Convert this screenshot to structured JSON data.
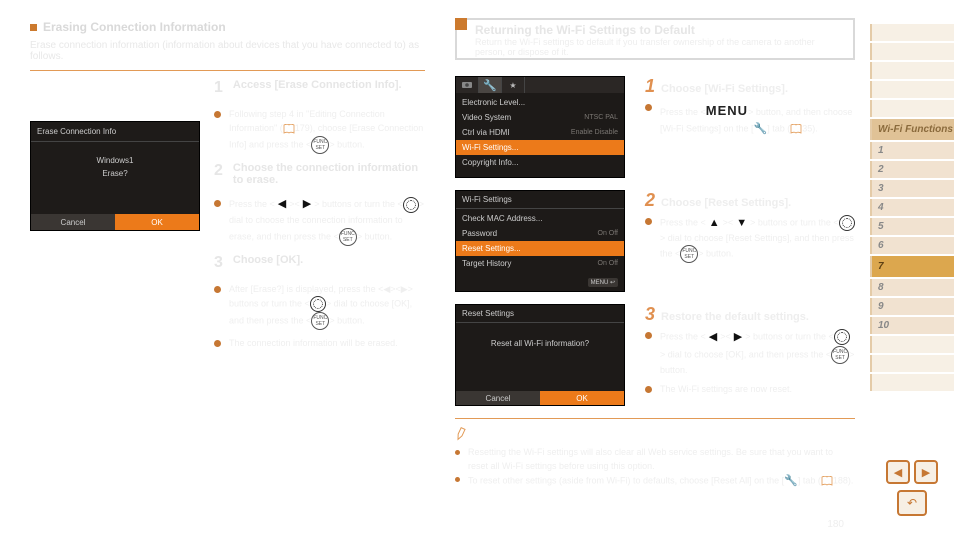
{
  "left": {
    "section_title": "Erasing Connection Information",
    "section_sub": "Erase connection information (information about devices that you have connected to) as follows.",
    "steps": [
      {
        "num": "1",
        "title": "Access [Erase Connection Info].",
        "items": [
          "Following step 4 in \"Editing Connection Information\" (📖179), choose [Erase Connection Info] and press the <⚙> button."
        ]
      },
      {
        "num": "2",
        "title": "Choose the connection information to erase.",
        "items": [
          "Press the <◀><▶> buttons or turn the <●> dial to choose the connection information to erase, and then press the <⚙> button."
        ]
      },
      {
        "num": "3",
        "title": "Choose [OK].",
        "items": [
          "After [Erase?] is displayed, press the <◀><▶> buttons or turn the <●> dial to choose [OK], and then press the <⚙> button.",
          "The connection information will be erased."
        ]
      }
    ],
    "dialog": {
      "title": "Erase Connection Info",
      "body1": "Windows1",
      "body2": "Erase?",
      "cancel": "Cancel",
      "ok": "OK"
    }
  },
  "right": {
    "head_title": "Returning the Wi-Fi Settings to Default",
    "head_sub": "Return the Wi-Fi settings to default if you transfer ownership of the camera to another person, or dispose of it.",
    "steps": [
      {
        "num": "1",
        "title": "Choose [Wi-Fi Settings].",
        "items": [
          "Press the <MENU> button, and then choose [Wi-Fi Settings] on the [🔧] tab (📖35)."
        ]
      },
      {
        "num": "2",
        "title": "Choose [Reset Settings].",
        "items": [
          "Press the <▲><▼> buttons or turn the <●> dial to choose [Reset Settings], and then press the <⚙> button."
        ]
      },
      {
        "num": "3",
        "title": "Restore the default settings.",
        "items": [
          "Press the <◀><▶> buttons or turn the <●> dial to choose [OK], and then press the <⚙> button.",
          "The Wi-Fi settings are now reset."
        ]
      }
    ],
    "screens": {
      "a_items": [
        {
          "t": "Electronic Level...",
          "v": ""
        },
        {
          "t": "Video System",
          "v": "NTSC  PAL"
        },
        {
          "t": "Ctrl via HDMI",
          "v": "Enable  Disable"
        },
        {
          "t": "Wi-Fi Settings...",
          "v": "",
          "sel": true
        },
        {
          "t": "Copyright Info...",
          "v": ""
        }
      ],
      "b_header": "Wi-Fi Settings",
      "b_items": [
        {
          "t": "Check MAC Address...",
          "v": ""
        },
        {
          "t": "Password",
          "v": "On  Off"
        },
        {
          "t": "Reset Settings...",
          "v": "",
          "sel": true
        },
        {
          "t": "Target History",
          "v": "On  Off"
        }
      ],
      "b_back": "MENU ↩",
      "c_header": "Reset Settings",
      "c_body": "Reset all Wi-Fi information?",
      "c_cancel": "Cancel",
      "c_ok": "OK"
    },
    "note": "• Resetting the Wi-Fi settings will also clear all Web service settings. Be sure that you want to reset all Wi-Fi settings before using this option.\n• To reset other settings (aside from Wi-Fi) to defaults, choose [Reset All] on the [🔧] tab (📖188).",
    "note_items": [
      "Resetting the Wi-Fi settings will also clear all Web service settings. Be sure that you want to reset all Wi-Fi settings before using this option.",
      "To reset other settings (aside from Wi-Fi) to defaults, choose [Reset All] on the [🔧] tab (📖188)."
    ]
  },
  "sidebar": {
    "blanks": 5,
    "category": "Wi-Fi Functions",
    "tabs": [
      "1",
      "2",
      "3",
      "4",
      "5",
      "6",
      "7",
      "8",
      "9",
      "10"
    ],
    "active": "7"
  },
  "page_number": "180",
  "menu_word": "MENU",
  "book_ref1": "179",
  "book_ref2": "35",
  "book_ref3": "188",
  "func_label": "FUNC SET"
}
